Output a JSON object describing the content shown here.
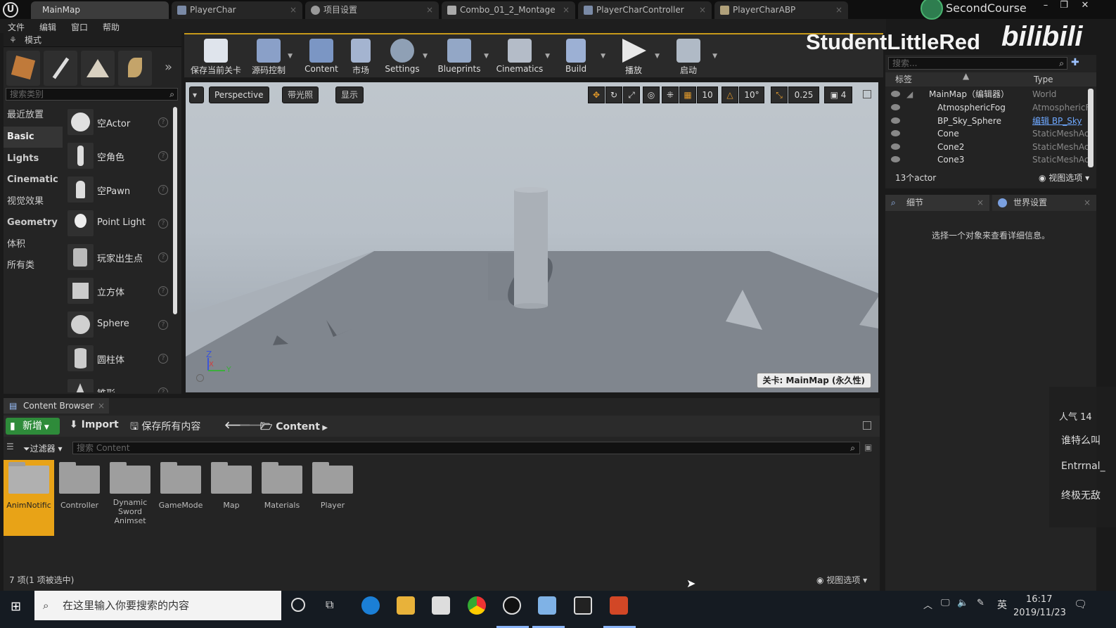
{
  "titlebar": {
    "tabs": [
      {
        "label": "MainMap"
      },
      {
        "label": "PlayerChar"
      },
      {
        "label": "项目设置"
      },
      {
        "label": "Combo_01_2_Montage"
      },
      {
        "label": "PlayerCharController"
      },
      {
        "label": "PlayerCharABP"
      }
    ],
    "project": "SecondCourse",
    "watermark": "StudentLittleRed",
    "watermark_logo": "bilibili"
  },
  "menu": [
    "文件",
    "编辑",
    "窗口",
    "帮助"
  ],
  "modes": {
    "title": "模式",
    "search_placeholder": "搜索类别",
    "categories": [
      "最近放置",
      "Basic",
      "Lights",
      "Cinematic",
      "视觉效果",
      "Geometry",
      "体积",
      "所有类"
    ],
    "items": [
      "空Actor",
      "空角色",
      "空Pawn",
      "Point Light",
      "玩家出生点",
      "立方体",
      "Sphere",
      "圆柱体",
      "锥形"
    ]
  },
  "toolbar": {
    "buttons": [
      "保存当前关卡",
      "源码控制",
      "Content",
      "市场",
      "Settings",
      "Blueprints",
      "Cinematics",
      "Build",
      "播放",
      "启动"
    ]
  },
  "viewport": {
    "perspective": "Perspective",
    "lit": "带光照",
    "show": "显示",
    "grid_snap": "10",
    "rot_snap": "10°",
    "scale_snap": "0.25",
    "camera_speed": "4",
    "level_label": "关卡: MainMap (永久性)",
    "axis_z": "Z",
    "axis_x": "X",
    "axis_y": "Y"
  },
  "outliner": {
    "search_placeholder": "搜索...",
    "col_label": "标签",
    "col_type": "Type",
    "rows": [
      {
        "name": "MainMap（编辑器）",
        "type": "World"
      },
      {
        "name": "AtmosphericFog",
        "type": "AtmosphericF"
      },
      {
        "name": "BP_Sky_Sphere",
        "type": "编辑 BP_Sky"
      },
      {
        "name": "Cone",
        "type": "StaticMeshAc"
      },
      {
        "name": "Cone2",
        "type": "StaticMeshAc"
      },
      {
        "name": "Cone3",
        "type": "StaticMeshAc"
      }
    ],
    "count": "13个actor",
    "view_options": "视图选项"
  },
  "details": {
    "tab_details": "细节",
    "tab_world": "世界设置",
    "empty_text": "选择一个对象来查看详细信息。"
  },
  "chat": {
    "popularity": "人气 14",
    "msgs": [
      "谁特么叫",
      "Entrrnal_",
      "终极无敌"
    ]
  },
  "content_browser": {
    "tab": "Content Browser",
    "new": "新增",
    "import": "Import",
    "save_all": "保存所有内容",
    "path": "Content",
    "filter": "过滤器",
    "search_placeholder": "搜索 Content",
    "folders": [
      "AnimNotific",
      "Controller",
      "Dynamic Sword Animset",
      "GameMode",
      "Map",
      "Materials",
      "Player"
    ],
    "status": "7 项(1 项被选中)",
    "view_options": "视图选项"
  },
  "taskbar": {
    "search_placeholder": "在这里输入你要搜索的内容",
    "ime": "英",
    "time": "16:17",
    "date": "2019/11/23"
  }
}
